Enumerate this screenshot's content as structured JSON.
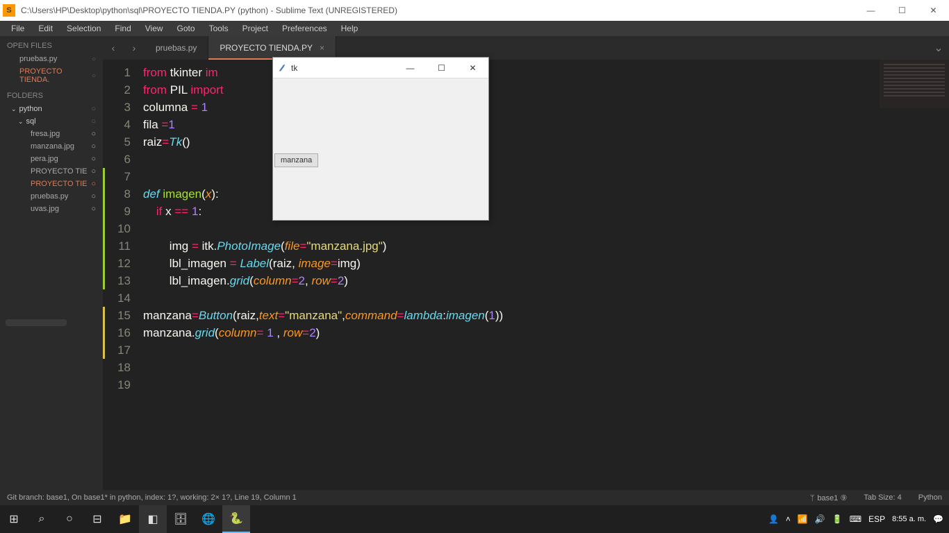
{
  "titlebar": {
    "path": "C:\\Users\\HP\\Desktop\\python\\sql\\PROYECTO TIENDA.PY (python) - Sublime Text (UNREGISTERED)"
  },
  "menu": [
    "File",
    "Edit",
    "Selection",
    "Find",
    "View",
    "Goto",
    "Tools",
    "Project",
    "Preferences",
    "Help"
  ],
  "sidebar": {
    "open_files_label": "OPEN FILES",
    "open_files": [
      {
        "name": "pruebas.py",
        "active": false
      },
      {
        "name": "PROYECTO TIENDA.",
        "active": true
      }
    ],
    "folders_label": "FOLDERS",
    "root_folder": "python",
    "sub_folder": "sql",
    "tree": [
      {
        "name": "fresa.jpg",
        "active": false
      },
      {
        "name": "manzana.jpg",
        "active": false
      },
      {
        "name": "pera.jpg",
        "active": false
      },
      {
        "name": "PROYECTO TIE",
        "active": false
      },
      {
        "name": "PROYECTO TIE",
        "active": true
      },
      {
        "name": "pruebas.py",
        "active": false
      },
      {
        "name": "uvas.jpg",
        "active": false
      }
    ]
  },
  "tabs": {
    "inactive": "pruebas.py",
    "active": "PROYECTO TIENDA.PY"
  },
  "code": {
    "lines": [
      "from tkinter im",
      "from PIL import",
      "columna = 1",
      "fila =1",
      "raiz=Tk()",
      "",
      "",
      "def imagen(x):",
      "    if x == 1:",
      "",
      "        img = itk.PhotoImage(file=\"manzana.jpg\")",
      "        lbl_imagen = Label(raiz, image=img)",
      "        lbl_imagen.grid(column=2, row=2)",
      "",
      "manzana=Button(raiz,text=\"manzana\",command=lambda:imagen(1))",
      "manzana.grid(column= 1 , row=2)",
      "",
      "",
      ""
    ]
  },
  "tk_window": {
    "title": "tk",
    "button_label": "manzana"
  },
  "statusbar": {
    "left": "Git branch: base1, On base1* in python, index: 1?, working: 2× 1?, Line 19, Column 1",
    "branch": "base1 ⑨",
    "tab_size": "Tab Size: 4",
    "lang": "Python"
  },
  "taskbar": {
    "lang": "ESP",
    "time": "8:55 a. m."
  }
}
